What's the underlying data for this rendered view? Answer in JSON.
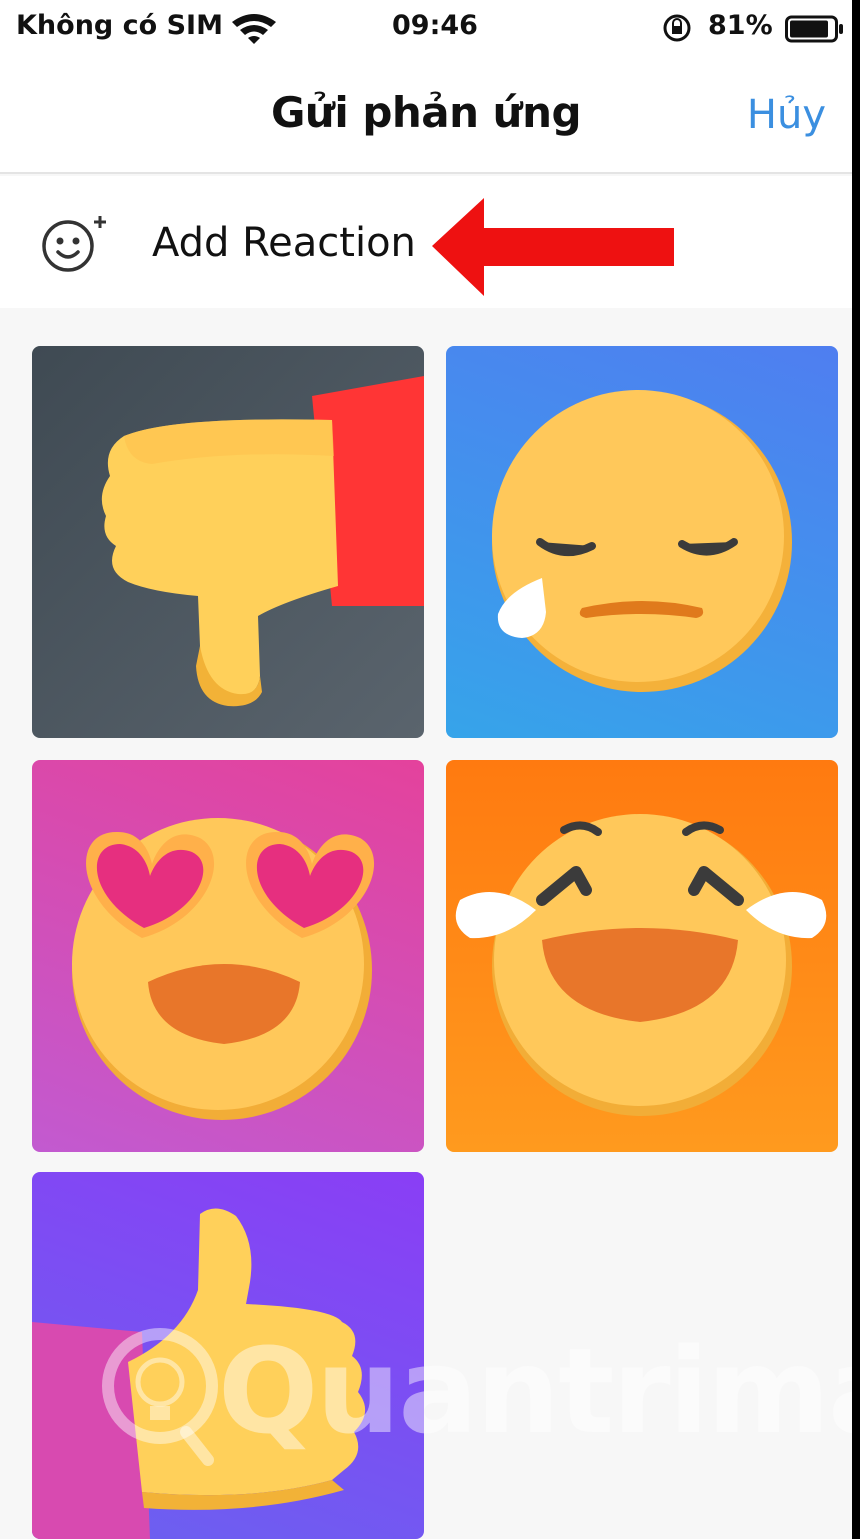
{
  "status_bar": {
    "carrier": "Không có SIM",
    "time": "09:46",
    "battery": "81%"
  },
  "nav": {
    "title": "Gửi phản ứng",
    "cancel": "Hủy"
  },
  "add_reaction": {
    "label": "Add Reaction"
  },
  "reactions": [
    {
      "icon": "thumbs-down-icon"
    },
    {
      "icon": "sad-tear-face-icon"
    },
    {
      "icon": "heart-eyes-face-icon"
    },
    {
      "icon": "laughing-tears-face-icon"
    },
    {
      "icon": "thumbs-up-icon"
    }
  ],
  "watermark": {
    "text": "Quantrimang"
  },
  "colors": {
    "accent": "#3b8fe0",
    "annotation_arrow": "#ee1111"
  }
}
